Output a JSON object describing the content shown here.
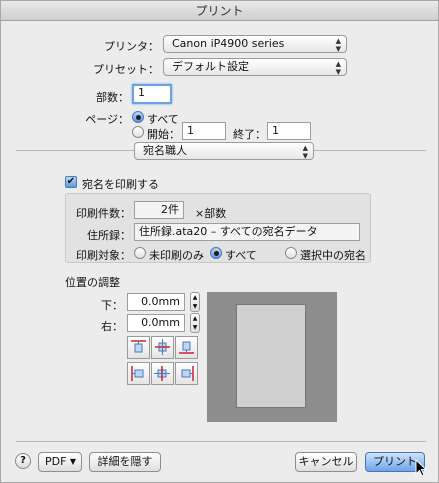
{
  "window": {
    "title": "プリント"
  },
  "printer": {
    "label": "プリンタ：",
    "value": "Canon iP4900 series"
  },
  "preset": {
    "label": "プリセット：",
    "value": "デフォルト設定"
  },
  "copies": {
    "label": "部数：",
    "value": "1"
  },
  "pages": {
    "label": "ページ：",
    "all_label": "すべて",
    "from_label": "開始：",
    "from_value": "1",
    "to_label": "終了：",
    "to_value": "1",
    "selected": "all"
  },
  "app_panel": {
    "value": "宛名職人"
  },
  "print_address": {
    "label": "宛名を印刷する",
    "checked": true
  },
  "print_settings": {
    "count_label": "印刷件数：",
    "count_value": "2件",
    "count_suffix": "×部数",
    "addressbook_label": "住所録：",
    "addressbook_value": "住所録.ata20 – すべての宛名データ",
    "target_label": "印刷対象：",
    "target_options": [
      "未印刷のみ",
      "すべて",
      "選択中の宛名"
    ],
    "target_selected": "すべて"
  },
  "position": {
    "header": "位置の調整",
    "down_label": "下：",
    "down_value": "0.0mm",
    "right_label": "右：",
    "right_value": "0.0mm",
    "align_icons": [
      "align-top-icon",
      "align-vertical-center-icon",
      "align-bottom-icon",
      "align-left-icon",
      "align-horizontal-center-icon",
      "align-right-icon"
    ]
  },
  "footer": {
    "help": "?",
    "pdf_label": "PDF",
    "details_label": "詳細を隠す",
    "cancel_label": "キャンセル",
    "print_label": "プリント"
  },
  "colors": {
    "accent": "#5f97e0",
    "background": "#ececec"
  }
}
